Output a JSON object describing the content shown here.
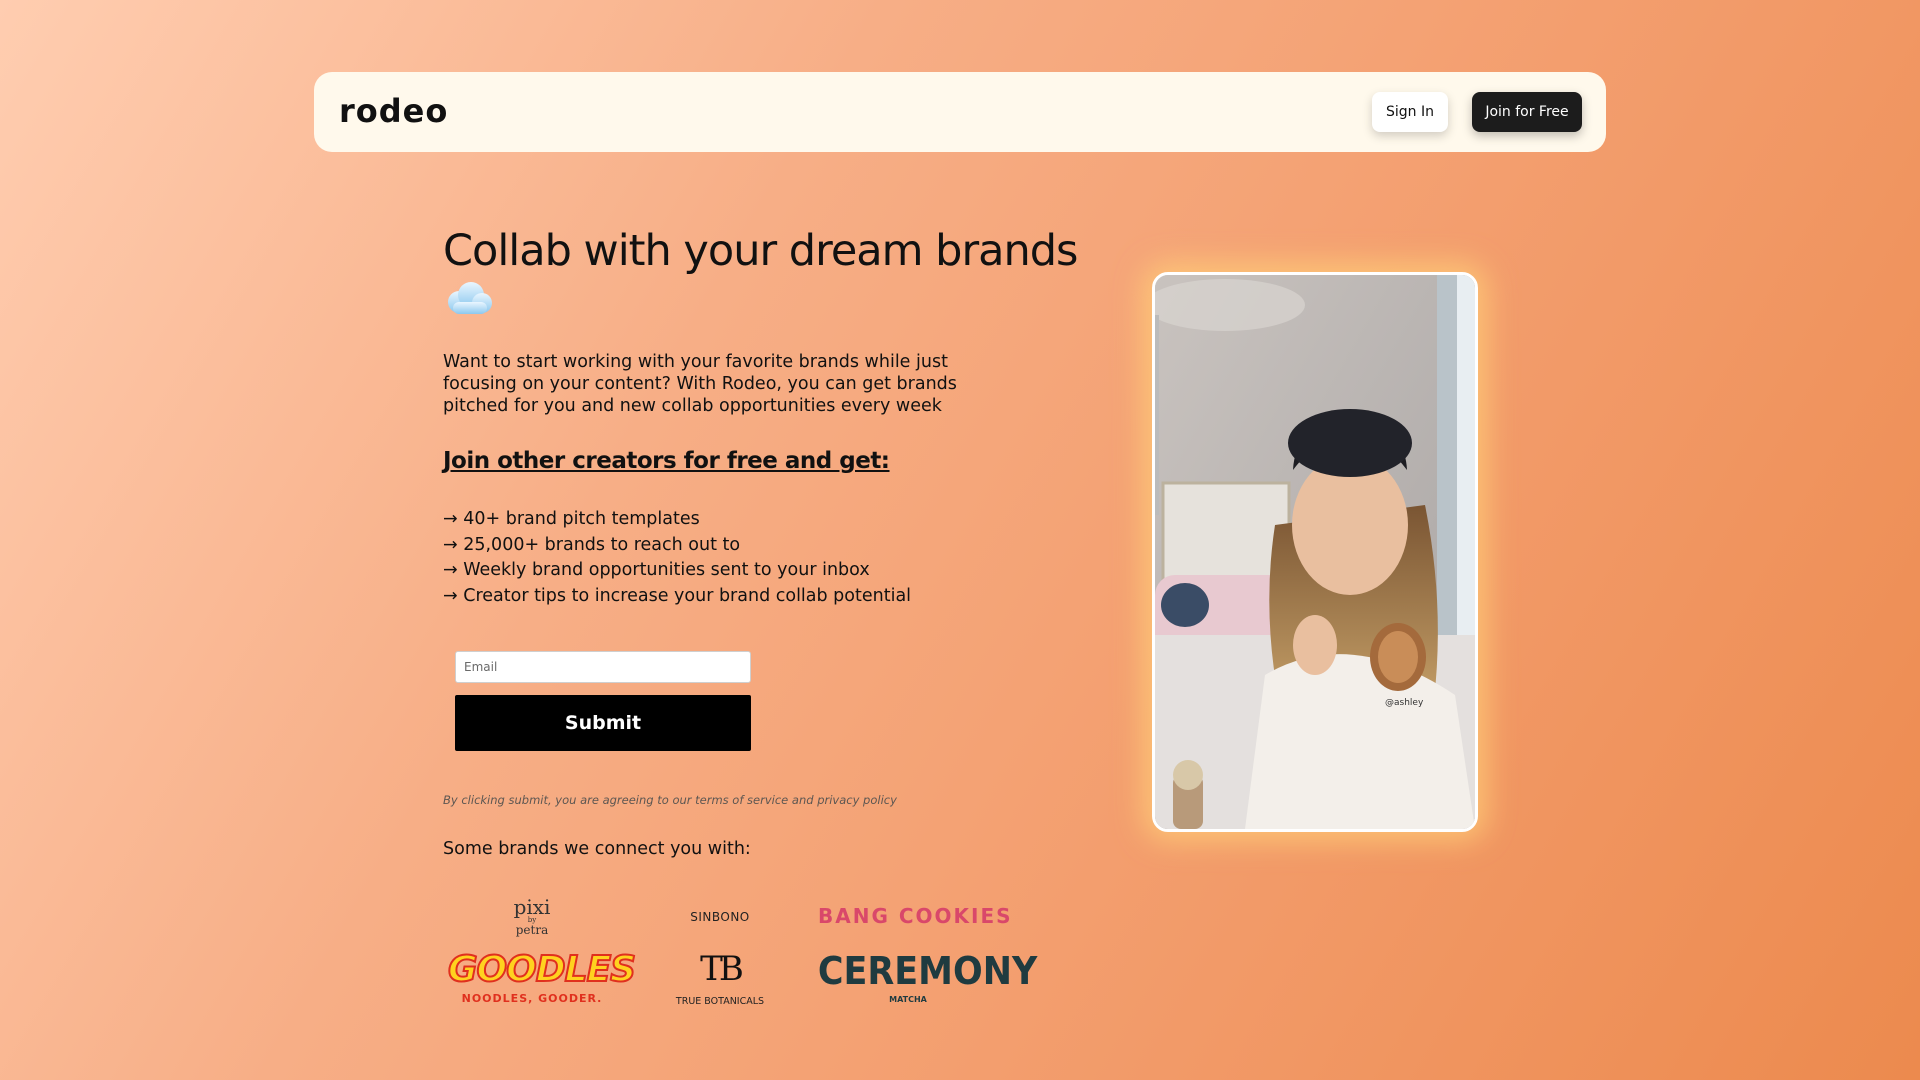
{
  "header": {
    "logo": "rodeo",
    "sign_in_label": "Sign In",
    "join_label": "Join for Free"
  },
  "hero": {
    "title": "Collab with your dream brands",
    "title_emoji": "cloud-icon",
    "intro": "Want to start working with your favorite brands while just focusing on your content? With Rodeo, you can get brands pitched for you and new collab opportunities every week",
    "join_heading": "Join other creators for free and get:",
    "benefits": [
      "→ 40+ brand pitch templates",
      "→ 25,000+ brands to reach out to",
      "→ Weekly brand opportunities sent to your inbox",
      "→ Creator tips to increase your brand collab potential"
    ]
  },
  "form": {
    "email_placeholder": "Email",
    "submit_label": "Submit",
    "disclaimer": "By clicking submit, you are agreeing to our terms of service and privacy policy"
  },
  "brands": {
    "heading": "Some brands we connect you with:",
    "logos": [
      {
        "name": "pixi",
        "line2": "by",
        "line3": "petra"
      },
      {
        "name": "SINBONO"
      },
      {
        "name": "BANG COOKIES"
      },
      {
        "name": "GOODLES",
        "tagline": "NOODLES, GOODER."
      },
      {
        "name": "TB",
        "tagline": "TRUE BOTANICALS"
      },
      {
        "name": "CEREMONY",
        "tagline": "MATCHA"
      }
    ]
  },
  "media": {
    "video_icon": "video-preview",
    "watermark": "@ashley"
  },
  "colors": {
    "background_start": "#ffcdb0",
    "background_end": "#ec8a4e",
    "nav_bg": "#fff9ec",
    "button_dark": "#1c1c1c",
    "bang_cookies": "#d9486a",
    "goodles_yellow": "#ffd21f",
    "goodles_red": "#e0301e",
    "ceremony_teal": "#1f3b40"
  }
}
